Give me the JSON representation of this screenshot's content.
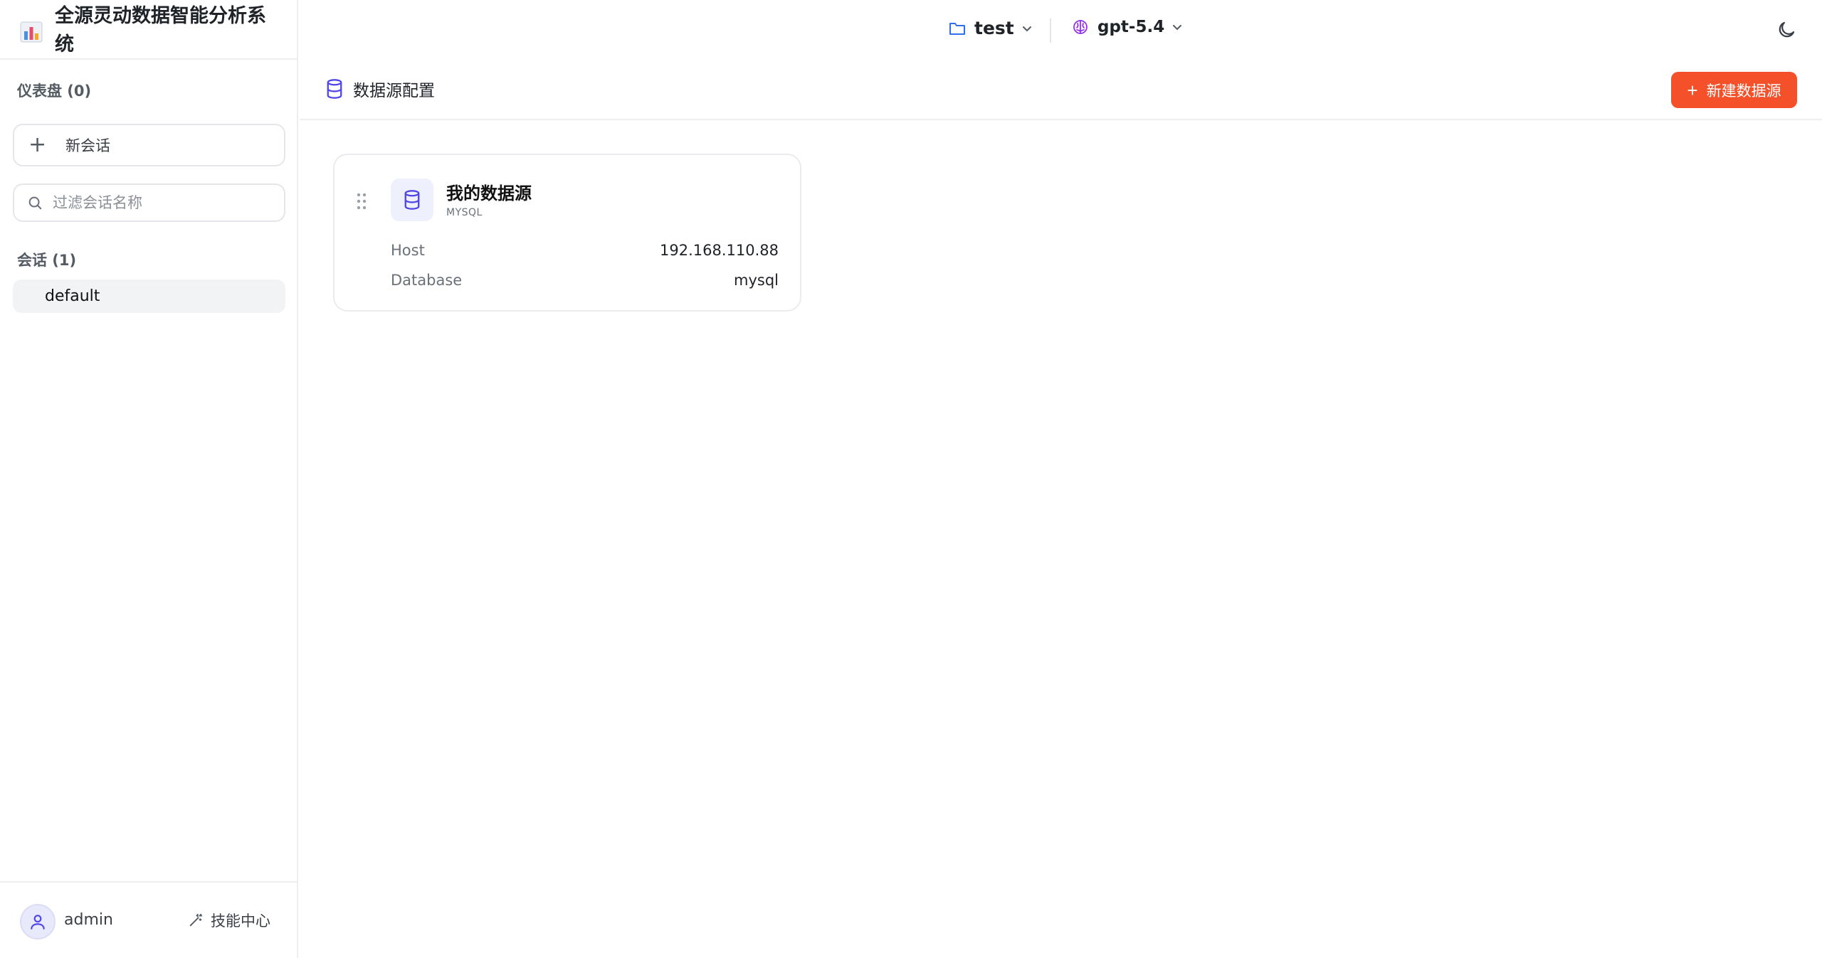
{
  "app": {
    "title": "全源灵动数据智能分析系统"
  },
  "sidebar": {
    "dashboards_label": "仪表盘 (0)",
    "new_chat_label": "新会话",
    "search_placeholder": "过滤会话名称",
    "sessions_label": "会话 (1)",
    "sessions": [
      {
        "name": "default"
      }
    ],
    "user_name": "admin",
    "skills_label": "技能中心"
  },
  "topbar": {
    "project": "test",
    "model": "gpt-5.4"
  },
  "main": {
    "title": "数据源配置",
    "new_datasource_label": "新建数据源",
    "datasources": [
      {
        "name": "我的数据源",
        "type": "MYSQL",
        "fields": [
          {
            "key": "Host",
            "value": "192.168.110.88"
          },
          {
            "key": "Database",
            "value": "mysql"
          }
        ]
      }
    ]
  },
  "colors": {
    "accent": "#f4502a",
    "icon_primary": "#4f46e5",
    "folder_icon": "#2f6fed",
    "model_icon": "#9333ea"
  },
  "icons": [
    "bar-chart-icon",
    "plus-icon",
    "search-icon",
    "user-icon",
    "magic-wand-icon",
    "folder-icon",
    "chevron-down-icon",
    "brain-icon",
    "moon-icon",
    "database-icon",
    "drag-handle-icon"
  ]
}
